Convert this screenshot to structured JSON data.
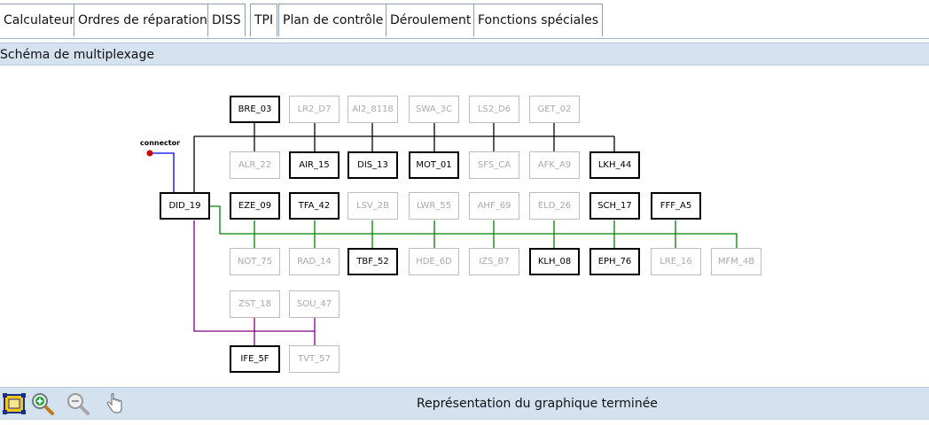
{
  "tabs": [
    {
      "label": "Calculateurs"
    },
    {
      "label": "Ordres de réparation"
    },
    {
      "label": "DISS"
    },
    {
      "label": "TPI"
    },
    {
      "label": "Plan de contrôle"
    },
    {
      "label": "Déroulement"
    },
    {
      "label": "Fonctions spéciales"
    }
  ],
  "section_title": "Schéma de multiplexage",
  "diagram": {
    "connector_label": "connector",
    "colors": {
      "bus_black": "#000000",
      "bus_blue": "#0000ff",
      "bus_green": "#008000",
      "bus_purple": "#800080",
      "connector_dot": "#cc0000"
    },
    "nodes": [
      {
        "label": "BRE_03",
        "active": true
      },
      {
        "label": "LR2_D7",
        "active": false
      },
      {
        "label": "AI2_8118",
        "active": false
      },
      {
        "label": "SWA_3C",
        "active": false
      },
      {
        "label": "LS2_D6",
        "active": false
      },
      {
        "label": "GET_02",
        "active": false
      },
      {
        "label": "ALR_22",
        "active": false
      },
      {
        "label": "AIR_15",
        "active": true
      },
      {
        "label": "DIS_13",
        "active": true
      },
      {
        "label": "MOT_01",
        "active": true
      },
      {
        "label": "SFS_CA",
        "active": false
      },
      {
        "label": "AFK_A9",
        "active": false
      },
      {
        "label": "LKH_44",
        "active": true
      },
      {
        "label": "DID_19",
        "active": true
      },
      {
        "label": "EZE_09",
        "active": true
      },
      {
        "label": "TFA_42",
        "active": true
      },
      {
        "label": "LSV_2B",
        "active": false
      },
      {
        "label": "LWR_55",
        "active": false
      },
      {
        "label": "AHF_69",
        "active": false
      },
      {
        "label": "ELD_26",
        "active": false
      },
      {
        "label": "SCH_17",
        "active": true
      },
      {
        "label": "FFF_A5",
        "active": true
      },
      {
        "label": "NOT_75",
        "active": false
      },
      {
        "label": "RAD_14",
        "active": false
      },
      {
        "label": "TBF_52",
        "active": true
      },
      {
        "label": "HDE_6D",
        "active": false
      },
      {
        "label": "IZS_B7",
        "active": false
      },
      {
        "label": "KLH_08",
        "active": true
      },
      {
        "label": "EPH_76",
        "active": true
      },
      {
        "label": "LRE_16",
        "active": false
      },
      {
        "label": "MFM_4B",
        "active": false
      },
      {
        "label": "ZST_18",
        "active": false
      },
      {
        "label": "SOU_47",
        "active": false
      },
      {
        "label": "IFE_5F",
        "active": true
      },
      {
        "label": "TVT_57",
        "active": false
      }
    ]
  },
  "toolbar": {
    "tools": [
      {
        "icon": "fit-to-screen-icon"
      },
      {
        "icon": "zoom-in-icon"
      },
      {
        "icon": "zoom-out-icon"
      },
      {
        "icon": "pan-hand-icon"
      }
    ]
  },
  "status_text": "Représentation du graphique terminée"
}
